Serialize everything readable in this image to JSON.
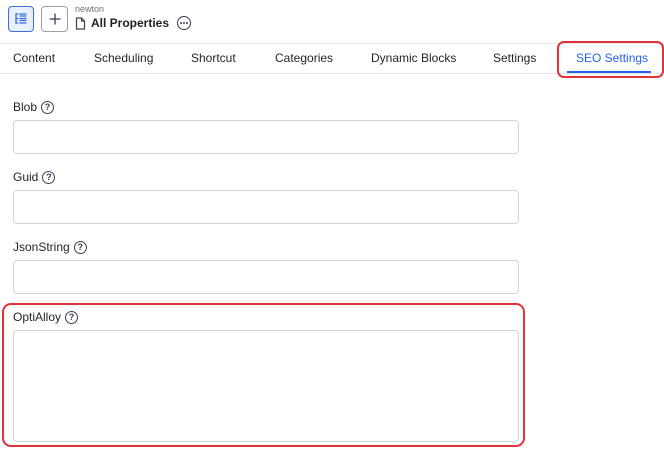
{
  "header": {
    "parent": "newton",
    "title": "All Properties"
  },
  "tabs": [
    {
      "label": "Content"
    },
    {
      "label": "Scheduling"
    },
    {
      "label": "Shortcut"
    },
    {
      "label": "Categories"
    },
    {
      "label": "Dynamic Blocks"
    },
    {
      "label": "Settings"
    },
    {
      "label": "SEO Settings",
      "active": true
    }
  ],
  "fields": [
    {
      "label": "Blob",
      "value": ""
    },
    {
      "label": "Guid",
      "value": ""
    },
    {
      "label": "JsonString",
      "value": ""
    },
    {
      "label": "OptiAlloy",
      "value": ""
    }
  ],
  "colors": {
    "accent": "#2563eb",
    "highlight": "#e0323a"
  }
}
